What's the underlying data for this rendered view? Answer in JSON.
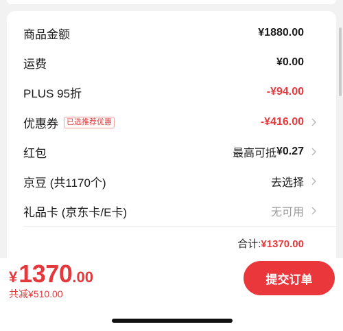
{
  "rows": [
    {
      "label": "商品金额",
      "value": "¥1880.00"
    },
    {
      "label": "运费",
      "value": "¥0.00"
    },
    {
      "label": "PLUS 95折",
      "value": "-¥94.00"
    },
    {
      "label": "优惠券",
      "tag": "已选推荐优惠",
      "value": "-¥416.00"
    },
    {
      "label": "红包",
      "value_prefix": "最高可抵",
      "value": "¥0.27"
    },
    {
      "label": "京豆 (共1170个)",
      "value": "去选择"
    },
    {
      "label": "礼品卡 (京东卡/E卡)",
      "value": "无可用"
    }
  ],
  "total": {
    "label": "合计:",
    "amount": "¥1370.00"
  },
  "footer": {
    "currency": "¥",
    "price_int": "1370",
    "price_dec": ".00",
    "reduced": "共减¥510.00",
    "submit_label": "提交订单"
  },
  "colors": {
    "accent": "#e4393c",
    "button": "#e9373c"
  }
}
